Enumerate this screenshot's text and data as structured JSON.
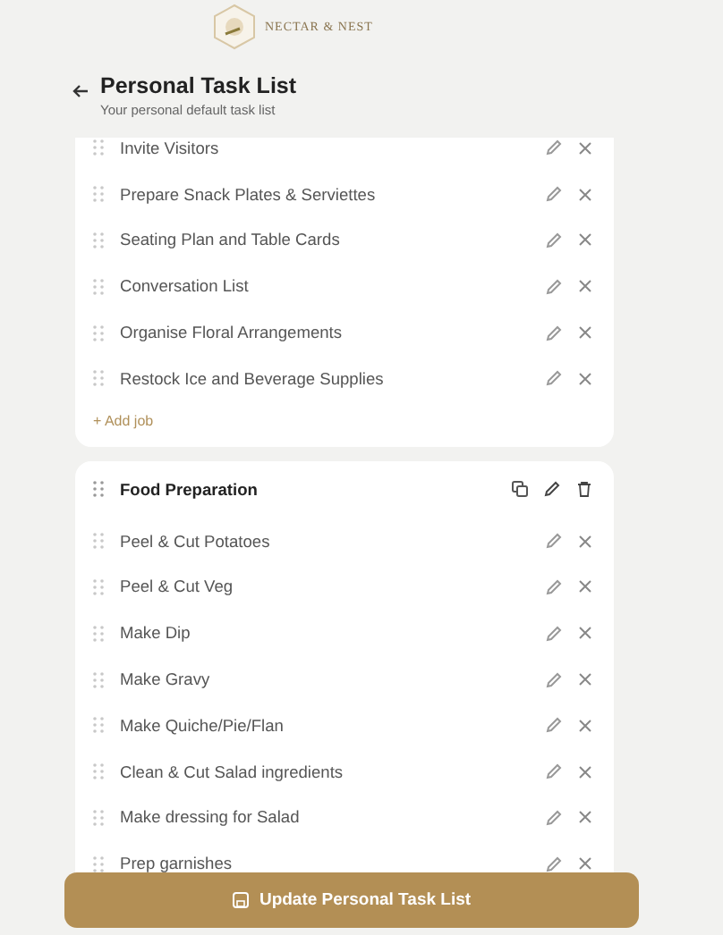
{
  "brand": {
    "name": "NECTAR & NEST"
  },
  "header": {
    "title": "Personal Task List",
    "subtitle": "Your personal default task list"
  },
  "sections": [
    {
      "add_label": "+ Add job",
      "jobs": [
        {
          "label": "Invite Visitors"
        },
        {
          "label": "Prepare Snack Plates & Serviettes"
        },
        {
          "label": "Seating Plan and Table Cards"
        },
        {
          "label": "Conversation List"
        },
        {
          "label": "Organise Floral Arrangements"
        },
        {
          "label": "Restock Ice and Beverage Supplies"
        }
      ]
    },
    {
      "title": "Food Preparation",
      "jobs": [
        {
          "label": "Peel & Cut Potatoes"
        },
        {
          "label": "Peel & Cut Veg"
        },
        {
          "label": "Make Dip"
        },
        {
          "label": "Make Gravy"
        },
        {
          "label": "Make Quiche/Pie/Flan"
        },
        {
          "label": "Clean & Cut Salad ingredients"
        },
        {
          "label": "Make dressing for Salad"
        },
        {
          "label": "Prep garnishes"
        }
      ]
    }
  ],
  "update_button": "Update Personal Task List"
}
